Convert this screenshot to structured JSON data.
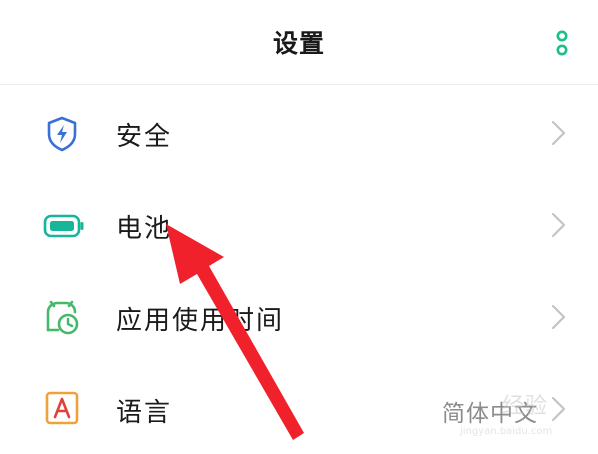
{
  "header": {
    "title": "设置",
    "more_icon": "more-vertical-icon",
    "accent_color": "#1dbf8a"
  },
  "settings": [
    {
      "label": "安全",
      "icon": "shield-bolt-icon",
      "value": "",
      "icon_color": "#3a6fd8"
    },
    {
      "label": "电池",
      "icon": "battery-icon",
      "value": "",
      "icon_color": "#17b59a"
    },
    {
      "label": "应用使用时间",
      "icon": "app-usage-clock-icon",
      "value": "",
      "icon_color": "#45b86a"
    },
    {
      "label": "语言",
      "icon": "language-icon",
      "value": "简体中文",
      "icon_color": "#f0a23a"
    }
  ],
  "annotation": {
    "arrow_color": "#f0212a"
  },
  "watermark": {
    "logo_text": "经验",
    "url": "jingyan.baidu.com"
  }
}
